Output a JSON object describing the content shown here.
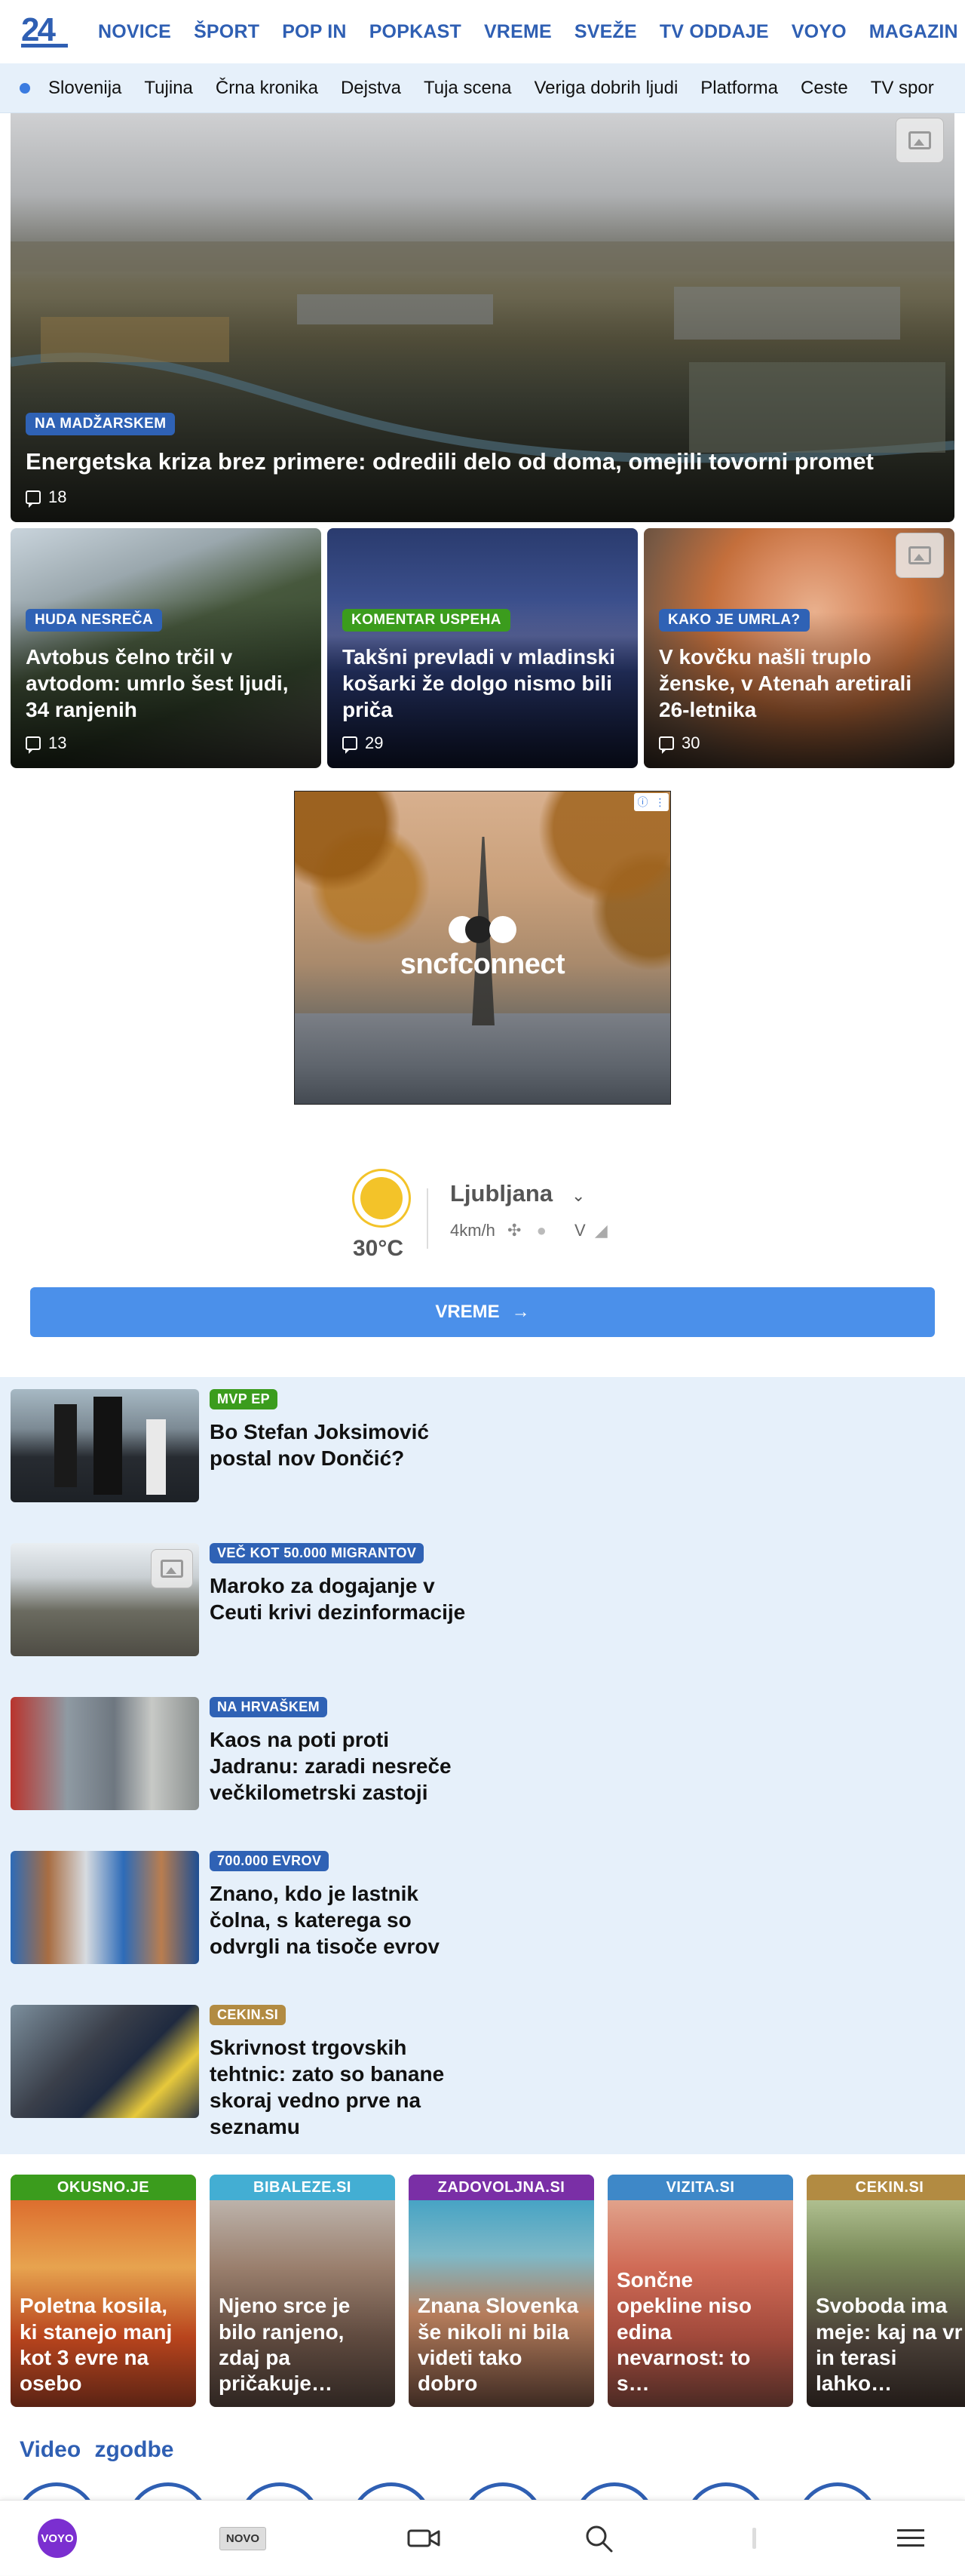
{
  "nav": {
    "logo": "24",
    "items": [
      "NOVICE",
      "ŠPORT",
      "POP IN",
      "POPKAST",
      "VREME",
      "SVEŽE",
      "TV ODDAJE",
      "VOYO",
      "MAGAZIN"
    ]
  },
  "subnav": {
    "items": [
      "Slovenija",
      "Tujina",
      "Črna kronika",
      "Dejstva",
      "Tuja scena",
      "Veriga dobrih ljudi",
      "Platforma",
      "Ceste",
      "TV spor"
    ]
  },
  "hero": {
    "tag": "NA MADŽARSKEM",
    "title": "Energetska kriza brez primere: odredili delo od doma, omejili tovorni promet",
    "comments": "18"
  },
  "small_cards": [
    {
      "tag": "HUDA NESREČA",
      "title": "Avtobus čelno trčil v avtodom: umrlo šest ljudi, 34 ranjenih",
      "comments": "13"
    },
    {
      "tag": "KOMENTAR USPEHA",
      "title": "Takšni prevladi v mladinski košarki že dolgo nismo bili priča",
      "comments": "29"
    },
    {
      "tag": "KAKO JE UMRLA?",
      "title": "V kovčku našli truplo ženske, v Atenah aretirali 26-letnika",
      "comments": "30"
    }
  ],
  "ad": {
    "brand": "sncfconnect"
  },
  "weather": {
    "temp": "30°C",
    "city": "Ljubljana",
    "wind": "4km/h",
    "wind_dir": "V",
    "button": "VREME"
  },
  "list": [
    {
      "tag": "MVP EP",
      "tag_color": "green",
      "title": "Bo Stefan Joksimović postal nov Dončić?"
    },
    {
      "tag": "VEČ KOT 50.000 MIGRANTOV",
      "tag_color": "blue",
      "title": "Maroko za dogajanje v Ceuti krivi dezinformacije"
    },
    {
      "tag": "NA HRVAŠKEM",
      "tag_color": "blue",
      "title": "Kaos na poti proti Jadranu: zaradi nesreče večkilometrski zastoji"
    },
    {
      "tag": "700.000 EVROV",
      "tag_color": "blue",
      "title": "Znano, kdo je lastnik čolna, s katerega so odvrgli na tisoče evrov"
    },
    {
      "tag": "CEKIN.SI",
      "tag_color": "gold",
      "title": "Skrivnost trgovskih tehtnic: zato so banane skoraj vedno prve na seznamu"
    }
  ],
  "partners": [
    {
      "site": "OKUSNO.JE",
      "color": "#3b9c1d",
      "title": "Poletna kosila, ki stanejo manj kot 3 evre na osebo"
    },
    {
      "site": "BIBALEZE.SI",
      "color": "#43aed3",
      "title": "Njeno srce je bilo ranjeno, zdaj pa pričakuje…"
    },
    {
      "site": "ZADOVOLJNA.SI",
      "color": "#7a2fa6",
      "title": "Znana Slovenka še nikoli ni bila videti tako dobro"
    },
    {
      "site": "VIZITA.SI",
      "color": "#3e88c8",
      "title": "Sončne opekline niso edina nevarnost: to s…"
    },
    {
      "site": "CEKIN.SI",
      "color": "#b28b42",
      "title": "Svoboda ima meje: kaj na vr in terasi lahko…"
    }
  ],
  "video": {
    "title": "Video zgodbe"
  },
  "bottom": {
    "voyo": "VOYO",
    "novo": "NOVO"
  }
}
